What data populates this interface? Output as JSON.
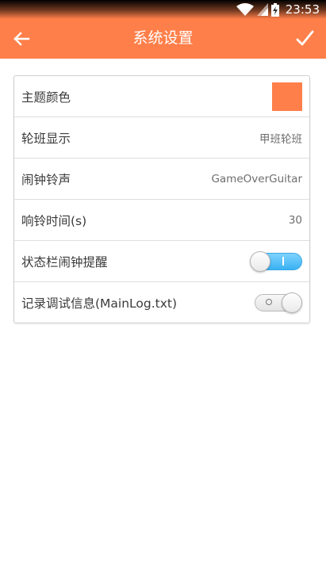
{
  "status_bar": {
    "time": "23:53",
    "icons": [
      "wifi-icon",
      "signal-icon",
      "battery-charging-icon"
    ]
  },
  "app_bar": {
    "title": "系统设置",
    "back_icon": "arrow-left-icon",
    "confirm_icon": "check-icon"
  },
  "colors": {
    "accent": "#ff7f4a",
    "toggle_on": "#39b2f2"
  },
  "settings": {
    "theme_color": {
      "label": "主题颜色",
      "color": "#ff7f4a"
    },
    "shift_display": {
      "label": "轮班显示",
      "value": "甲班轮班"
    },
    "alarm_ringtone": {
      "label": "闹钟铃声",
      "value": "GameOverGuitar"
    },
    "ring_duration": {
      "label": "响铃时间(s)",
      "value": "30"
    },
    "statusbar_reminder": {
      "label": "状态栏闹钟提醒",
      "enabled": true
    },
    "debug_log": {
      "label": "记录调试信息(MainLog.txt)",
      "enabled": false
    }
  }
}
